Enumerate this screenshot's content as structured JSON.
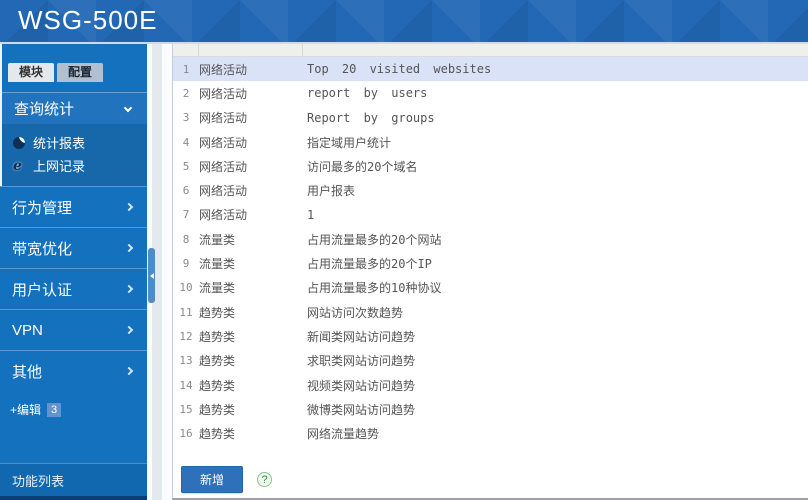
{
  "header": {
    "title": "WSG-500E"
  },
  "sidebar": {
    "tabs": [
      {
        "label": "模块",
        "active": true
      },
      {
        "label": "配置",
        "active": false
      }
    ],
    "query_menu": {
      "label": "查询统计"
    },
    "submenu": [
      {
        "icon": "pie-chart-icon",
        "label": "统计报表"
      },
      {
        "icon": "ie-browser-icon",
        "label": "上网记录"
      }
    ],
    "menus": [
      {
        "label": "行为管理"
      },
      {
        "label": "带宽优化"
      },
      {
        "label": "用户认证"
      },
      {
        "label": "VPN"
      },
      {
        "label": "其他"
      }
    ],
    "edit": {
      "label": "+编辑",
      "badge": "3"
    },
    "footer_label": "功能列表"
  },
  "table": {
    "rows": [
      {
        "num": "1",
        "category": "网络活动",
        "description": "Top 20 visited websites",
        "selected": true
      },
      {
        "num": "2",
        "category": "网络活动",
        "description": "report by users",
        "selected": false
      },
      {
        "num": "3",
        "category": "网络活动",
        "description": "Report by groups",
        "selected": false
      },
      {
        "num": "4",
        "category": "网络活动",
        "description": "指定域用户统计",
        "selected": false
      },
      {
        "num": "5",
        "category": "网络活动",
        "description": "访问最多的20个域名",
        "selected": false
      },
      {
        "num": "6",
        "category": "网络活动",
        "description": "用户报表",
        "selected": false
      },
      {
        "num": "7",
        "category": "网络活动",
        "description": "1",
        "selected": false
      },
      {
        "num": "8",
        "category": "流量类",
        "description": "占用流量最多的20个网站",
        "selected": false
      },
      {
        "num": "9",
        "category": "流量类",
        "description": "占用流量最多的20个IP",
        "selected": false
      },
      {
        "num": "10",
        "category": "流量类",
        "description": "占用流量最多的10种协议",
        "selected": false
      },
      {
        "num": "11",
        "category": "趋势类",
        "description": "网站访问次数趋势",
        "selected": false
      },
      {
        "num": "12",
        "category": "趋势类",
        "description": "新闻类网站访问趋势",
        "selected": false
      },
      {
        "num": "13",
        "category": "趋势类",
        "description": "求职类网站访问趋势",
        "selected": false
      },
      {
        "num": "14",
        "category": "趋势类",
        "description": "视频类网站访问趋势",
        "selected": false
      },
      {
        "num": "15",
        "category": "趋势类",
        "description": "微博类网站访问趋势",
        "selected": false
      },
      {
        "num": "16",
        "category": "趋势类",
        "description": "网络流量趋势",
        "selected": false
      }
    ]
  },
  "footer": {
    "add_button_label": "新增",
    "help_icon": "?"
  },
  "colors": {
    "header_blue": "#2268b5",
    "sidebar_blue": "#1471bd",
    "submenu_blue": "#1767ab",
    "row_highlight": "#d9e2f6",
    "button_blue": "#2e71ba",
    "help_green": "#2f8f2f"
  }
}
